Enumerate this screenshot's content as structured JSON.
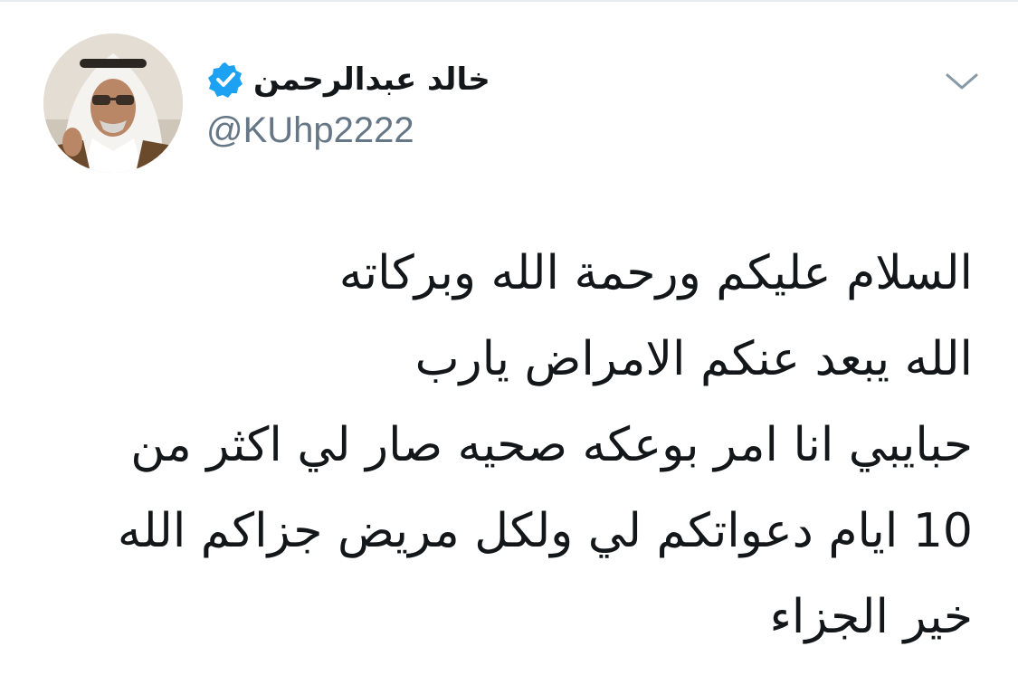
{
  "author": {
    "display_name": "خالد عبدالرحمن",
    "handle": "@KUhp2222",
    "verified": true,
    "avatar_icon": "profile-photo"
  },
  "menu": {
    "icon": "chevron-down-icon"
  },
  "tweet": {
    "lines": [
      "السلام عليكم ورحمة الله وبركاته",
      "الله يبعد عنكم الامراض يارب",
      "حبايبي انا امر بوعكه صحيه صار لي اكثر من",
      "10 ايام دعواتكم لي ولكل مريض جزاكم الله",
      "خير الجزاء"
    ]
  },
  "colors": {
    "text": "#14171a",
    "secondary": "#657786",
    "verified": "#1da1f2",
    "chevron": "#8899a6"
  }
}
